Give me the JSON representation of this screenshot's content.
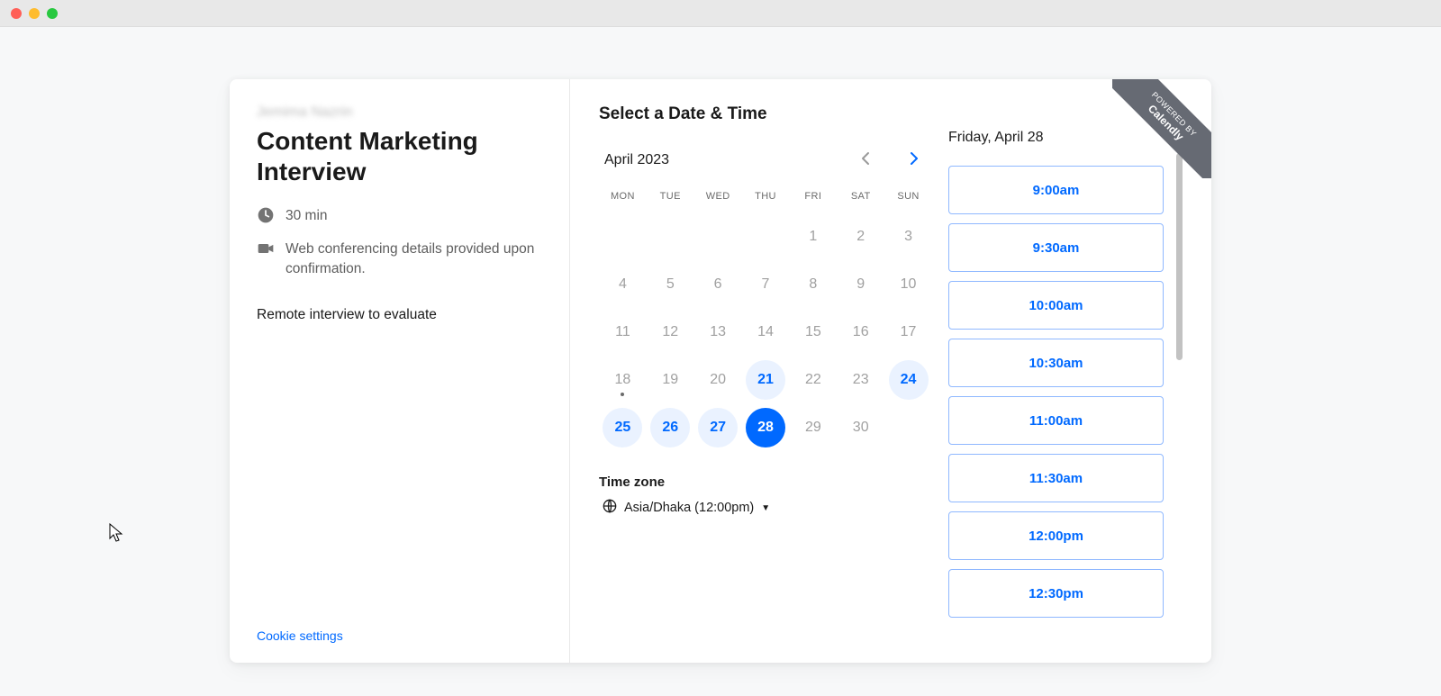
{
  "browser": {
    "traffic_lights": [
      "red",
      "yellow",
      "green"
    ]
  },
  "badge": {
    "powered_by": "POWERED BY",
    "brand": "Calendly"
  },
  "event": {
    "host_name": "Jemima Nazrin",
    "title": "Content Marketing Interview",
    "duration": "30 min",
    "location": "Web conferencing details provided upon confirmation.",
    "description": "Remote interview to evaluate"
  },
  "cookie_link": "Cookie settings",
  "picker_title": "Select a Date & Time",
  "calendar": {
    "month_label": "April 2023",
    "dows": [
      "MON",
      "TUE",
      "WED",
      "THU",
      "FRI",
      "SAT",
      "SUN"
    ],
    "leading_blanks": 4,
    "days": [
      {
        "n": 1
      },
      {
        "n": 2
      },
      {
        "n": 3
      },
      {
        "n": 4
      },
      {
        "n": 5
      },
      {
        "n": 6
      },
      {
        "n": 7
      },
      {
        "n": 8
      },
      {
        "n": 9
      },
      {
        "n": 10
      },
      {
        "n": 11
      },
      {
        "n": 12
      },
      {
        "n": 13
      },
      {
        "n": 14
      },
      {
        "n": 15
      },
      {
        "n": 16
      },
      {
        "n": 17
      },
      {
        "n": 18,
        "today": true
      },
      {
        "n": 19
      },
      {
        "n": 20
      },
      {
        "n": 21,
        "available": true
      },
      {
        "n": 22
      },
      {
        "n": 23
      },
      {
        "n": 24,
        "available": true
      },
      {
        "n": 25,
        "available": true
      },
      {
        "n": 26,
        "available": true
      },
      {
        "n": 27,
        "available": true
      },
      {
        "n": 28,
        "selected": true
      },
      {
        "n": 29
      },
      {
        "n": 30
      }
    ]
  },
  "timezone": {
    "label": "Time zone",
    "value": "Asia/Dhaka (12:00pm)"
  },
  "selected_date_label": "Friday, April 28",
  "times": [
    "9:00am",
    "9:30am",
    "10:00am",
    "10:30am",
    "11:00am",
    "11:30am",
    "12:00pm",
    "12:30pm"
  ]
}
